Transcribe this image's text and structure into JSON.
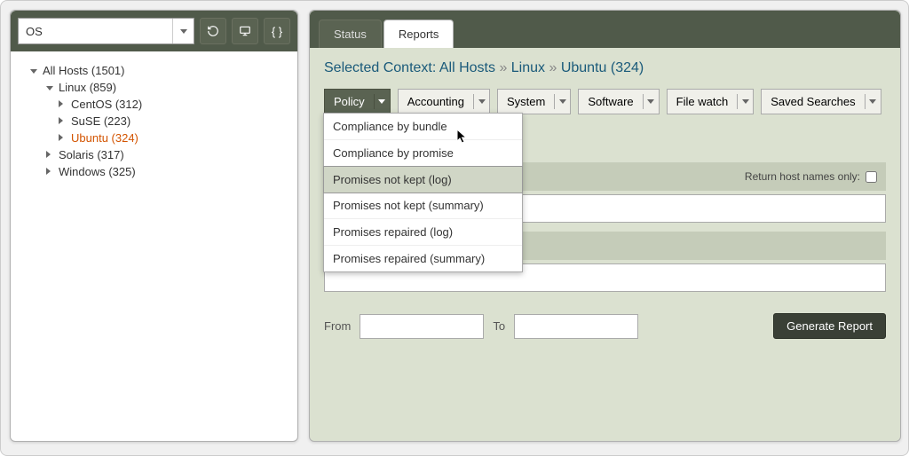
{
  "left": {
    "selector_label": "OS",
    "tree": {
      "root": {
        "label": "All Hosts (1501)"
      },
      "linux": {
        "label": "Linux (859)"
      },
      "centos": {
        "label": "CentOS (312)"
      },
      "suse": {
        "label": "SuSE (223)"
      },
      "ubuntu": {
        "label": "Ubuntu (324)"
      },
      "solaris": {
        "label": "Solaris (317)"
      },
      "windows": {
        "label": "Windows (325)"
      }
    }
  },
  "tabs": {
    "status": "Status",
    "reports": "Reports"
  },
  "breadcrumb": {
    "prefix": "Selected Context: ",
    "p1": "All Hosts",
    "p2": "Linux",
    "p3": "Ubuntu (324)"
  },
  "filters": {
    "policy": "Policy",
    "accounting": "Accounting",
    "system": "System",
    "software": "Software",
    "filewatch": "File watch",
    "saved": "Saved Searches"
  },
  "menu": {
    "m1": "Compliance by bundle",
    "m2": "Compliance by promise",
    "m3": "Promises not kept (log)",
    "m4": "Promises not kept (summary)",
    "m5": "Promises repaired (log)",
    "m6": "Promises repaired (summary)"
  },
  "form": {
    "return_hosts": "Return host names only:",
    "from": "From",
    "to": "To",
    "generate": "Generate Report"
  }
}
